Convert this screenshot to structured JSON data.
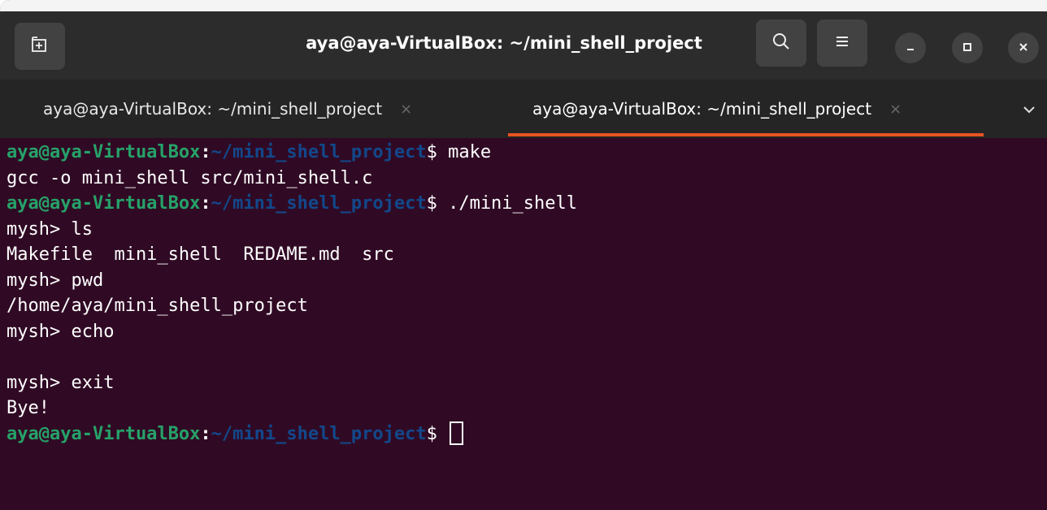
{
  "window": {
    "title": "aya@aya-VirtualBox: ~/mini_shell_project"
  },
  "tabs": [
    {
      "label": "aya@aya-VirtualBox: ~/mini_shell_project",
      "active": false
    },
    {
      "label": "aya@aya-VirtualBox: ~/mini_shell_project",
      "active": true
    }
  ],
  "icons": {
    "new_tab": "new-tab-icon",
    "search": "search-icon",
    "menu": "hamburger-menu-icon",
    "minimize": "minimize-icon",
    "maximize": "maximize-icon",
    "close": "close-icon",
    "tab_close": "×",
    "tabs_dropdown": "chevron-down-icon"
  },
  "colors": {
    "terminal_bg": "#300a24",
    "prompt_user": "#26a269",
    "prompt_path": "#12488b",
    "accent": "#e95420"
  },
  "prompt": {
    "user": "aya@aya-VirtualBox",
    "colon": ":",
    "path": "~/mini_shell_project",
    "dollar": "$ "
  },
  "terminal": {
    "line1_cmd": "make",
    "line2": "gcc -o mini_shell src/mini_shell.c",
    "line3_cmd": "./mini_shell",
    "line4": "mysh> ls",
    "line5": "Makefile  mini_shell  REDAME.md  src",
    "line6": "mysh> pwd",
    "line7": "/home/aya/mini_shell_project",
    "line8": "mysh> echo",
    "line9": "",
    "line10": "mysh> exit",
    "line11": "Bye!",
    "line12_cmd": ""
  }
}
